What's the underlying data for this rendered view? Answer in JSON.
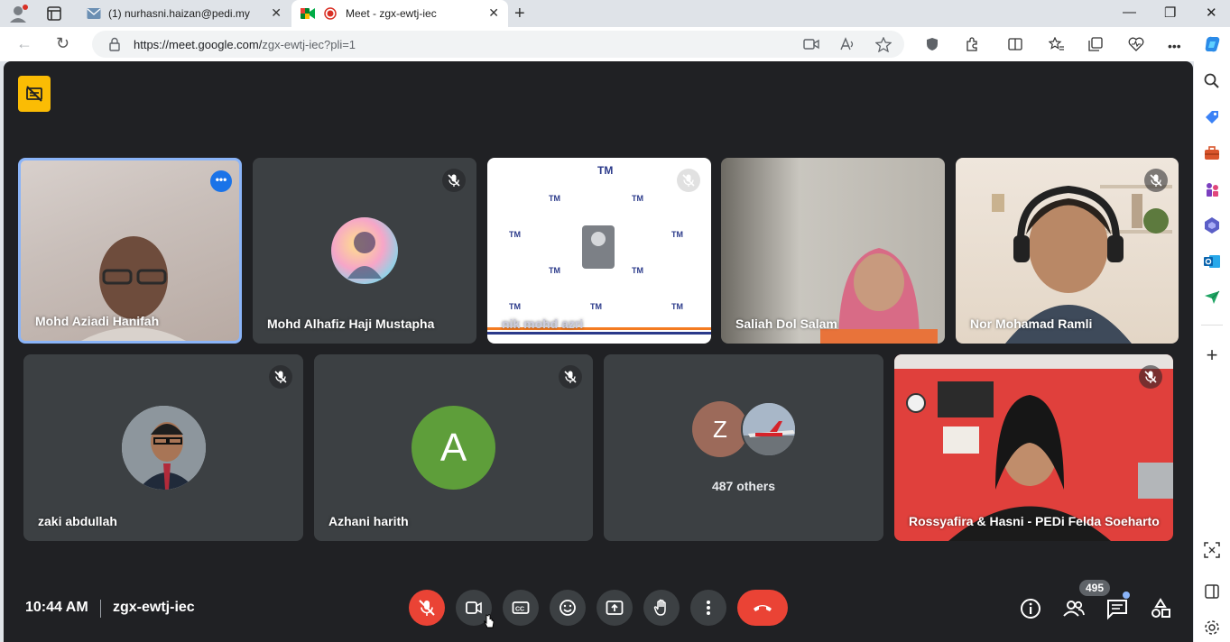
{
  "browser": {
    "tabs": [
      {
        "title": "(1) nurhasni.haizan@pedi.my"
      },
      {
        "title": "Meet - zgx-ewtj-iec"
      }
    ],
    "url": {
      "host": "https://meet.google.com/",
      "path": "zgx-ewtj-iec?pli=1"
    }
  },
  "meeting": {
    "time": "10:44 AM",
    "separator": "|",
    "code": "zgx-ewtj-iec",
    "participants_count": "495",
    "others_label": "487 others",
    "others_avatar_letter": "Z"
  },
  "tiles": [
    {
      "name": "Mohd Aziadi Hanifah"
    },
    {
      "name": "Mohd Alhafiz Haji Mustapha"
    },
    {
      "name": "nik mohd azri"
    },
    {
      "name": "Saliah Dol Salam"
    },
    {
      "name": "Nor Mohamad Ramli"
    },
    {
      "name": "zaki abdullah"
    },
    {
      "name": "Azhani harith",
      "letter": "A"
    },
    {
      "name": "Rossyafira & Hasni - PEDi Felda Soeharto"
    }
  ],
  "colors": {
    "meet_bg": "#202124",
    "tile_bg": "#3c4043",
    "hangup_red": "#ea4335",
    "active_speaker_border": "#8ab4f8",
    "recording_badge": "#fbbc04",
    "letter_avatar_green": "#5e9e3a",
    "z_avatar": "#9c6a5a"
  }
}
